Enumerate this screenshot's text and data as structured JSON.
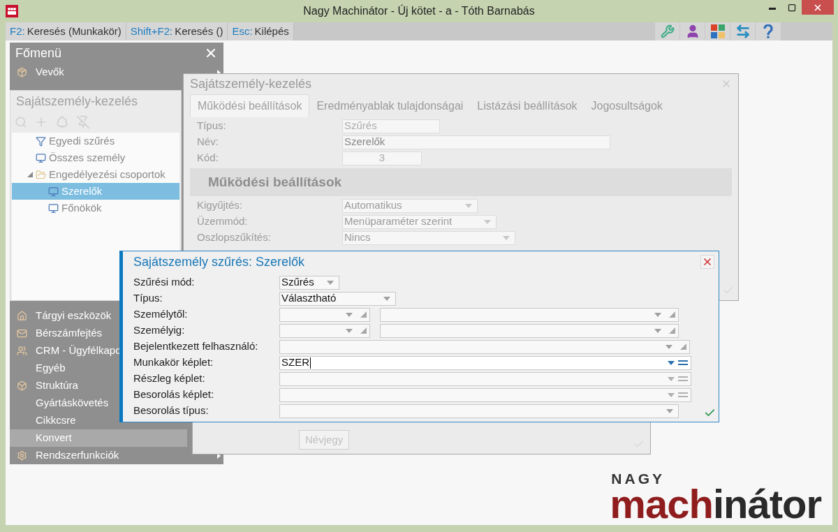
{
  "window": {
    "title": "Nagy Machinátor - Új kötet - a - Tóth Barnabás"
  },
  "shortcuts": [
    {
      "key": "F2:",
      "label": "Keresés (Munkakör)"
    },
    {
      "key": "Shift+F2:",
      "label": "Keresés ()"
    },
    {
      "key": "Esc:",
      "label": "Kilépés"
    }
  ],
  "main_menu": {
    "title": "Főmenü",
    "items_top": [
      {
        "label": "Vevők",
        "has_icon": true,
        "submenu": true,
        "selected": false
      }
    ],
    "items_bottom": [
      {
        "label": "Tárgyi eszközök",
        "has_icon": true,
        "selected": false
      },
      {
        "label": "Bérszámfejtés",
        "has_icon": true,
        "selected": false
      },
      {
        "label": "CRM - Ügyfélkapc",
        "has_icon": true,
        "selected": false
      },
      {
        "label": "Egyéb",
        "has_icon": false,
        "selected": false
      },
      {
        "label": "Struktúra",
        "has_icon": true,
        "selected": false
      },
      {
        "label": "Gyártáskövetés",
        "has_icon": false,
        "selected": false
      },
      {
        "label": "Cikkcsre",
        "has_icon": false,
        "selected": false
      },
      {
        "label": "Konvert",
        "has_icon": false,
        "selected": true
      },
      {
        "label": "Rendszerfunkciók",
        "has_icon": true,
        "submenu": true,
        "selected": false
      }
    ]
  },
  "tree_panel": {
    "title": "Sajátszemély-kezelés",
    "items": [
      {
        "label": "Egyedi szűrés",
        "kind": "filter",
        "selected": false
      },
      {
        "label": "Összes személy",
        "kind": "person",
        "selected": false
      },
      {
        "label": "Engedélyezési csoportok",
        "kind": "folder",
        "expanded": true,
        "selected": false,
        "children": [
          {
            "label": "Szerelők",
            "kind": "person",
            "selected": true
          },
          {
            "label": "Főnökök",
            "kind": "person",
            "selected": false
          }
        ]
      }
    ]
  },
  "settings_window": {
    "title": "Sajátszemély-kezelés",
    "tabs": [
      {
        "label": "Működési beállítások",
        "selected": true
      },
      {
        "label": "Eredményablak tulajdonságai",
        "selected": false
      },
      {
        "label": "Listázási beállítások",
        "selected": false
      },
      {
        "label": "Jogosultságok",
        "selected": false
      }
    ],
    "fields": [
      {
        "label": "Típus:",
        "value": "Szűrés",
        "kind": "text",
        "disabled": true
      },
      {
        "label": "Név:",
        "value": "Szerelők",
        "kind": "wide",
        "disabled": false
      },
      {
        "label": "Kód:",
        "value": "3",
        "kind": "number",
        "disabled": true
      }
    ],
    "section_title": "Működési beállítások",
    "selects": [
      {
        "label": "Kigyűjtés:",
        "value": "Automatikus"
      },
      {
        "label": "Üzemmód:",
        "value": "Menüparaméter szerint"
      },
      {
        "label": "Oszlopszűkítés:",
        "value": "Nincs"
      }
    ]
  },
  "lower_window": {
    "button": "Névjegy",
    "button_disabled": true
  },
  "filter_dialog": {
    "title": "Sajátszemély szűrés: Szerelők",
    "rows": [
      {
        "label": "Szűrési mód:",
        "kind": "select_small",
        "value": "Szűrés"
      },
      {
        "label": "Típus:",
        "kind": "select_medium",
        "value": "Választható"
      },
      {
        "label": "Személytől:",
        "kind": "pair"
      },
      {
        "label": "Személyig:",
        "kind": "pair"
      },
      {
        "label": "Bejelentkezett felhasználó:",
        "kind": "combo"
      },
      {
        "label": "Munkakör képlet:",
        "kind": "formula",
        "value": "SZER",
        "focused": true
      },
      {
        "label": "Részleg képlet:",
        "kind": "formula",
        "focused": false
      },
      {
        "label": "Besorolás képlet:",
        "kind": "formula",
        "focused": false
      },
      {
        "label": "Besorolás típus:",
        "kind": "select_wide"
      }
    ]
  },
  "logo": {
    "top": "NAGY",
    "word": "machinátor"
  }
}
